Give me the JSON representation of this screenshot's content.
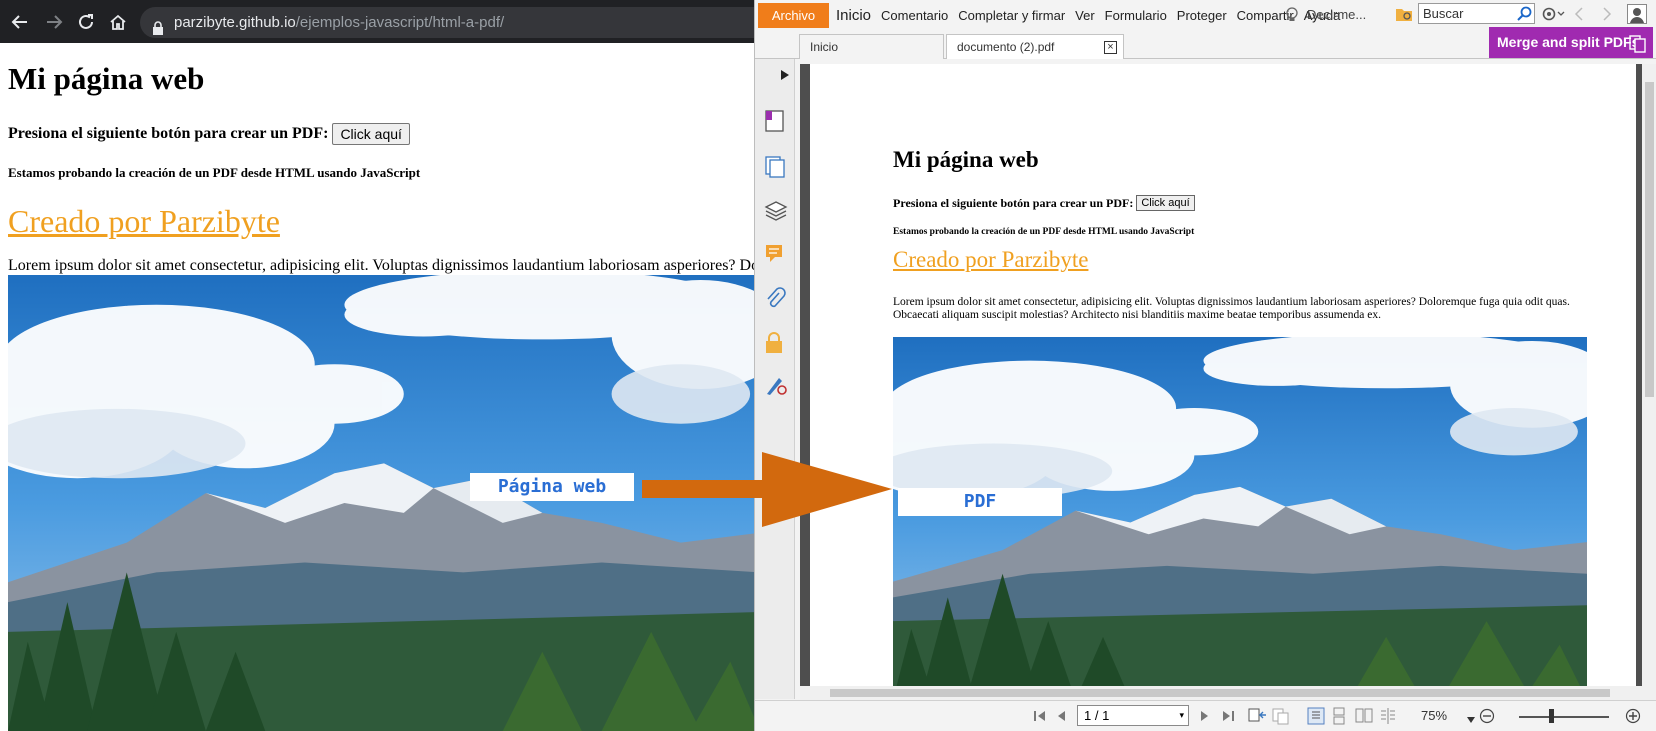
{
  "browser": {
    "url_host": "parzibyte.github.io",
    "url_path": "/ejemplos-javascript/html-a-pdf/"
  },
  "webpage": {
    "heading": "Mi página web",
    "prompt_text": "Presiona el siguiente botón para crear un PDF:",
    "button_label": "Click aquí",
    "subheading": "Estamos probando la creación de un PDF desde HTML usando JavaScript",
    "link_text": "Creado por Parzibyte",
    "paragraph": "Lorem ipsum dolor sit amet consectetur, adipisicing elit. Voluptas dignissimos laudantium laboriosam asperiores? Doloremque fuga quia odit quas. Obcaecati aliquam suscipit molestias? Architecto nisi blanditiis maxime beatae temporibus assumenda ex.",
    "paragraph_visible": "Lorem ipsum dolor sit amet consectetur, adipisicing elit. Voluptas dignissimos laudantium laboriosam asperiores? Do",
    "label": "Página web"
  },
  "reader": {
    "menu": {
      "file": "Archivo",
      "items": [
        "Inicio",
        "Comentario",
        "Completar y firmar",
        "Ver",
        "Formulario",
        "Proteger",
        "Compartir",
        "Ayuda"
      ],
      "tell_me": "Decirme...",
      "search_placeholder": "Buscar"
    },
    "tabs": [
      {
        "label": "Inicio"
      },
      {
        "label": "documento (2).pdf"
      }
    ],
    "merge_banner": "Merge and split PDFs",
    "page_indicator": "1 / 1",
    "zoom": "75%",
    "link_color": "#f0a020",
    "accent_color": "#f07d1a",
    "banner_color": "#a02ab0"
  },
  "pdf_page": {
    "heading": "Mi página web",
    "prompt_text": "Presiona el siguiente botón para crear un PDF:",
    "button_label": "Click aquí",
    "subheading": "Estamos probando la creación de un PDF desde HTML usando JavaScript",
    "link_text": "Creado por Parzibyte",
    "paragraph": "Lorem ipsum dolor sit amet consectetur, adipisicing elit. Voluptas dignissimos laudantium laboriosam asperiores? Doloremque fuga quia odit quas. Obcaecati aliquam suscipit molestias? Architecto nisi blanditiis maxime beatae temporibus assumenda ex.",
    "label": "PDF"
  }
}
